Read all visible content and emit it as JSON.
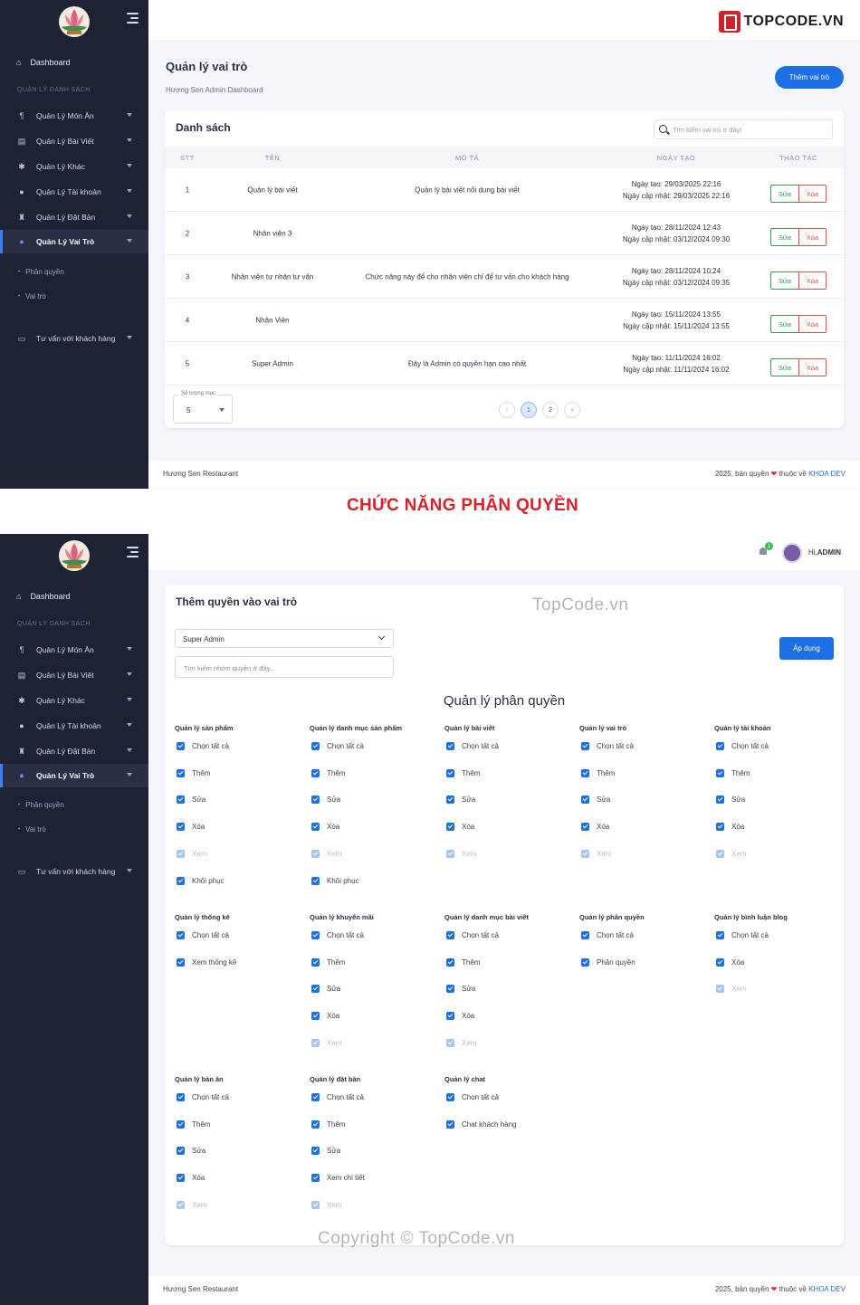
{
  "sidebar": {
    "dashboard": "Dashboard",
    "section": "QUẢN LÝ DANH SÁCH",
    "items": [
      {
        "label": "Quản Lý Món Ăn",
        "icon": "utensils-icon"
      },
      {
        "label": "Quản Lý Bài Viết",
        "icon": "newspaper-icon"
      },
      {
        "label": "Quản Lý Khác",
        "icon": "cogs-icon"
      },
      {
        "label": "Quản Lý Tài khoản",
        "icon": "users-icon"
      },
      {
        "label": "Quản Lý Đặt Bàn",
        "icon": "chair-icon"
      },
      {
        "label": "Quản Lý Vai Trò",
        "icon": "user-cog-icon"
      }
    ],
    "sub_items": [
      "Phân quyền",
      "Vai trò"
    ],
    "chat": "Tư vấn với khách hàng"
  },
  "brand_logo": "TOPCODE.VN",
  "screen1": {
    "title": "Quản lý vai trò",
    "subtitle": "Hương Sen Admin Dashboard",
    "add_button": "Thêm vai trò",
    "card_title": "Danh sách",
    "search_placeholder": "Tìm kiếm vai trò ở đây!",
    "columns": [
      "STT",
      "TÊN",
      "MÔ TẢ",
      "NGÀY TẠO",
      "THAO TÁC"
    ],
    "rows": [
      {
        "stt": "1",
        "name": "Quản lý bài viết",
        "desc": "Quản lý bài viết nổi dung bài viết",
        "created": "Ngày tạo: 29/03/2025 22:16",
        "updated": "Ngày cập nhật: 29/03/2025 22:16"
      },
      {
        "stt": "2",
        "name": "Nhân viên 3",
        "desc": "",
        "created": "Ngày tạo: 28/11/2024 12:43",
        "updated": "Ngày cập nhật: 03/12/2024 09:30"
      },
      {
        "stt": "3",
        "name": "Nhân viên tư nhân tư vấn",
        "desc": "Chức năng này để cho nhân viên chỉ để tư vấn cho khách hàng",
        "created": "Ngày tạo: 28/11/2024 10:24",
        "updated": "Ngày cập nhật: 03/12/2024 09:35"
      },
      {
        "stt": "4",
        "name": "Nhân Viên",
        "desc": "",
        "created": "Ngày tạo: 15/11/2024 13:55",
        "updated": "Ngày cập nhật: 15/11/2024 13:55"
      },
      {
        "stt": "5",
        "name": "Super Admin",
        "desc": "Đây là Admin có quyền hạn cao nhất",
        "created": "Ngày tạo: 11/11/2024 16:02",
        "updated": "Ngày cập nhật: 11/11/2024 16:02"
      }
    ],
    "edit_label": "Sửa",
    "delete_label": "Xóa",
    "page_size_label": "Số lượng mục",
    "page_size": "5",
    "pages": [
      "1",
      "2"
    ],
    "prev": "‹",
    "next": "›"
  },
  "footer": {
    "left": "Hương Sen Restaurant",
    "right_prefix": "2025, bản quyền",
    "heart": "❤",
    "right_mid": "thuộc về",
    "author": "KHOA DEV"
  },
  "banner": "CHỨC NĂNG PHÂN QUYỀN",
  "screen2": {
    "notif_count": "1",
    "greeting": "Hi,",
    "user": "ADMIN",
    "card_title": "Thêm quyền vào vai trò",
    "selected_role": "Super Admin",
    "group_search_placeholder": "Tìm kiếm nhóm quyền ở đây...",
    "apply_button": "Áp dụng",
    "heading": "Quản lý phân quyền",
    "groups": [
      {
        "title": "Quản lý sản phẩm",
        "options": [
          "Chọn tất cả",
          "Thêm",
          "Sửa",
          "Xóa",
          "Xem",
          "Khôi phục"
        ],
        "disabled": [
          4
        ]
      },
      {
        "title": "Quản lý danh mục sản phẩm",
        "options": [
          "Chọn tất cả",
          "Thêm",
          "Sửa",
          "Xóa",
          "Xem",
          "Khôi phục"
        ],
        "disabled": [
          4
        ]
      },
      {
        "title": "Quản lý bài viết",
        "options": [
          "Chọn tất cả",
          "Thêm",
          "Sửa",
          "Xóa",
          "Xem"
        ],
        "disabled": [
          4
        ]
      },
      {
        "title": "Quản lý vai trò",
        "options": [
          "Chọn tất cả",
          "Thêm",
          "Sửa",
          "Xóa",
          "Xem"
        ],
        "disabled": [
          4
        ]
      },
      {
        "title": "Quản lý tài khoản",
        "options": [
          "Chọn tất cả",
          "Thêm",
          "Sửa",
          "Xóa",
          "Xem"
        ],
        "disabled": [
          4
        ]
      },
      {
        "title": "Quản lý thống kê",
        "options": [
          "Chọn tất cả",
          "Xem thống kê"
        ],
        "disabled": []
      },
      {
        "title": "Quản lý khuyến mãi",
        "options": [
          "Chọn tất cả",
          "Thêm",
          "Sửa",
          "Xóa",
          "Xem"
        ],
        "disabled": [
          4
        ]
      },
      {
        "title": "Quản lý danh mục bài viết",
        "options": [
          "Chọn tất cả",
          "Thêm",
          "Sửa",
          "Xóa",
          "Xem"
        ],
        "disabled": [
          4
        ]
      },
      {
        "title": "Quản lý phân quyền",
        "options": [
          "Chọn tất cả",
          "Phân quyền"
        ],
        "disabled": []
      },
      {
        "title": "Quản lý bình luận blog",
        "options": [
          "Chọn tất cả",
          "Xóa",
          "Xem"
        ],
        "disabled": [
          2
        ]
      },
      {
        "title": "Quản lý bàn ăn",
        "options": [
          "Chọn tất cả",
          "Thêm",
          "Sửa",
          "Xóa",
          "Xem"
        ],
        "disabled": [
          4
        ]
      },
      {
        "title": "Quản lý đặt bàn",
        "options": [
          "Chọn tất cả",
          "Thêm",
          "Sửa",
          "Xem chi tiết",
          "Xem"
        ],
        "disabled": [
          4
        ]
      },
      {
        "title": "Quản lý chat",
        "options": [
          "Chọn tất cả",
          "Chat khách hàng"
        ],
        "disabled": []
      }
    ]
  },
  "watermarks": [
    "TopCode.vn",
    "Copyright © TopCode.vn"
  ],
  "colors": {
    "sidebar": "#1e2235",
    "accent": "#1d6fe5",
    "edit": "#2e9b4e",
    "delete": "#e24b4b",
    "banner": "#d8222a"
  }
}
